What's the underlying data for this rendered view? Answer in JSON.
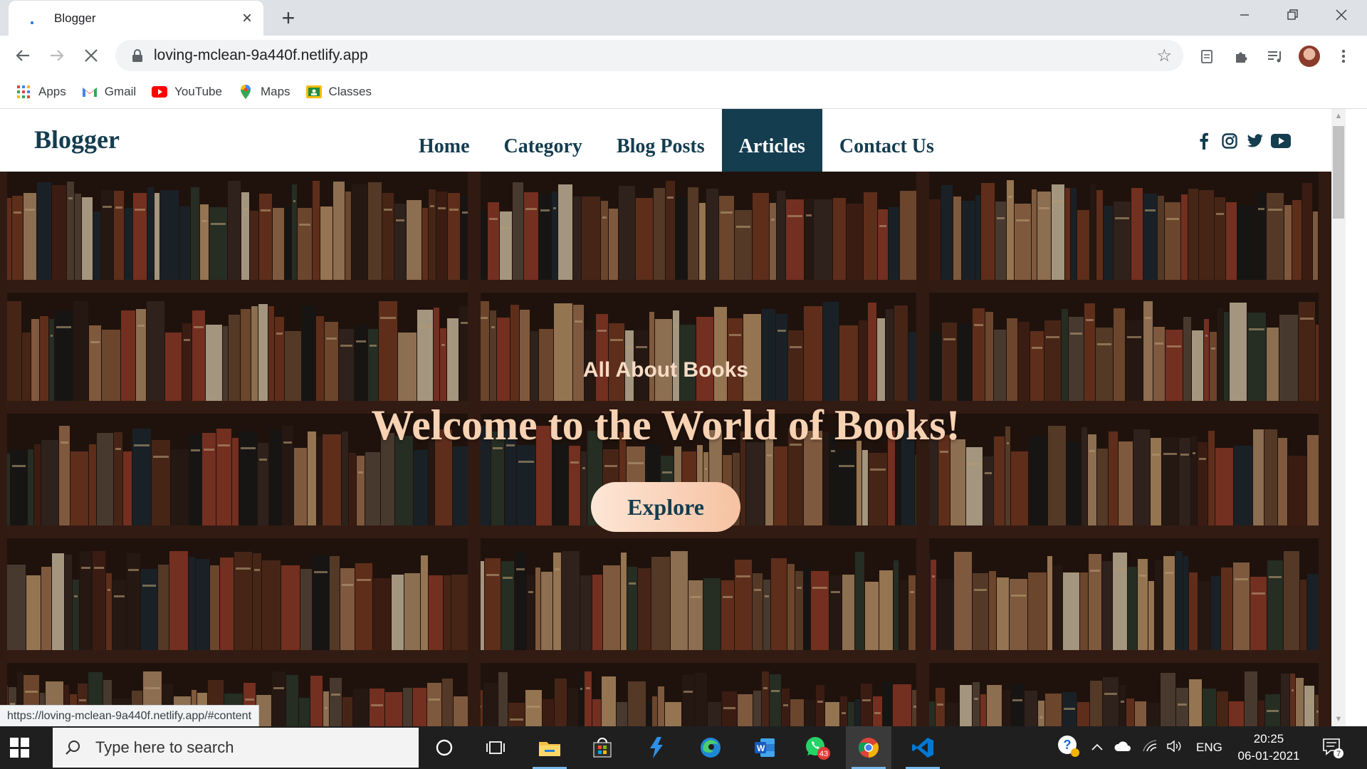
{
  "browser": {
    "tab_title": "Blogger",
    "url": "loving-mclean-9a440f.netlify.app",
    "bookmarks": [
      {
        "label": "Apps",
        "icon": "apps-grid-icon"
      },
      {
        "label": "Gmail",
        "icon": "gmail-icon"
      },
      {
        "label": "YouTube",
        "icon": "youtube-icon"
      },
      {
        "label": "Maps",
        "icon": "maps-icon"
      },
      {
        "label": "Classes",
        "icon": "classroom-icon"
      }
    ],
    "status_link": "https://loving-mclean-9a440f.netlify.app/#content"
  },
  "site": {
    "brand": "Blogger",
    "nav": [
      {
        "label": "Home",
        "active": false
      },
      {
        "label": "Category",
        "active": false
      },
      {
        "label": "Blog Posts",
        "active": false
      },
      {
        "label": "Articles",
        "active": true
      },
      {
        "label": "Contact Us",
        "active": false
      }
    ],
    "social": [
      "facebook-icon",
      "instagram-icon",
      "twitter-icon",
      "youtube-icon"
    ],
    "hero": {
      "subtitle": "All About Books",
      "title": "Welcome to the World of Books!",
      "button": "Explore"
    },
    "colors": {
      "brand": "#143d4f",
      "hero_text": "#f7d2b3",
      "button_start": "#fde6d6",
      "button_end": "#f6c2a2"
    }
  },
  "taskbar": {
    "search_placeholder": "Type here to search",
    "whatsapp_badge": "43",
    "language": "ENG",
    "time": "20:25",
    "date": "06-01-2021",
    "notification_count": "7"
  }
}
